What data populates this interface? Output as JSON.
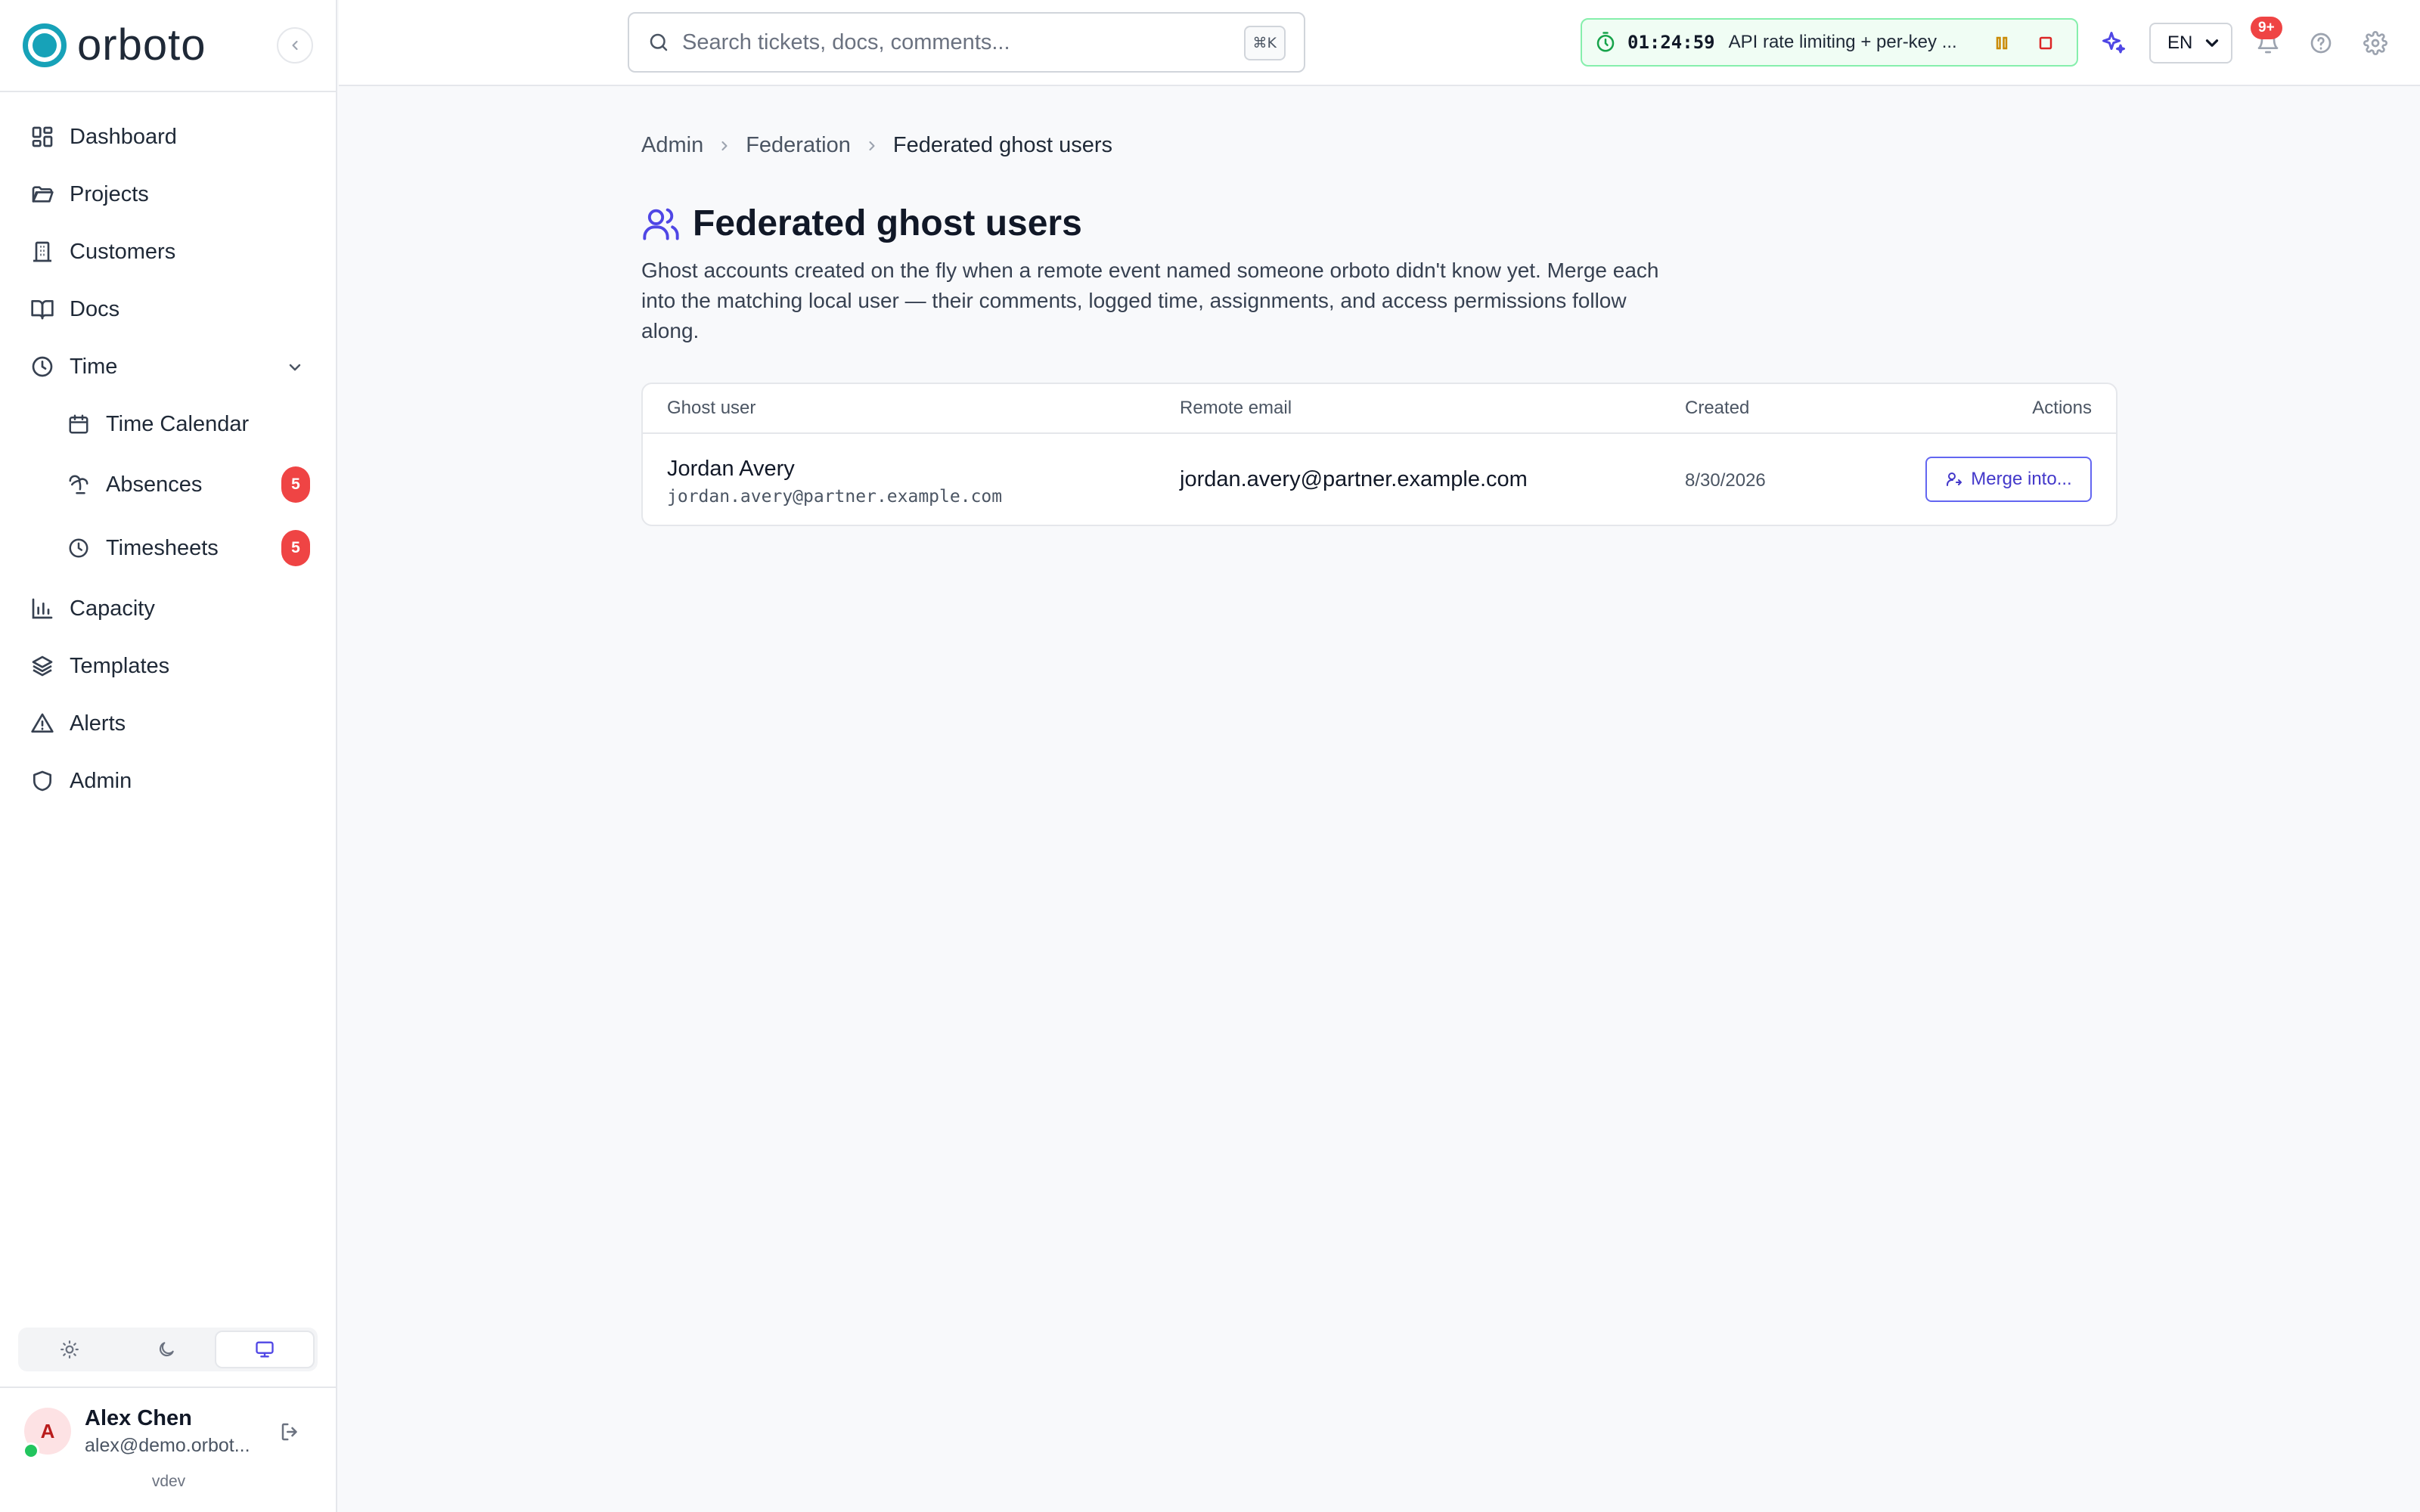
{
  "app": {
    "brand": "orboto",
    "version": "vdev"
  },
  "colors": {
    "brand": "#17a2b8",
    "accent": "#4f46e5",
    "danger": "#ef4444",
    "success": "#22c55e"
  },
  "sidebar": {
    "items": [
      {
        "label": "Dashboard",
        "icon": "dashboard-icon"
      },
      {
        "label": "Projects",
        "icon": "folder-icon"
      },
      {
        "label": "Customers",
        "icon": "building-icon"
      },
      {
        "label": "Docs",
        "icon": "book-icon"
      },
      {
        "label": "Time",
        "icon": "clock-icon"
      },
      {
        "label": "Capacity",
        "icon": "bar-chart-icon"
      },
      {
        "label": "Templates",
        "icon": "layers-icon"
      },
      {
        "label": "Alerts",
        "icon": "warning-icon"
      },
      {
        "label": "Admin",
        "icon": "shield-icon"
      }
    ],
    "time_children": [
      {
        "label": "Time Calendar",
        "icon": "calendar-icon"
      },
      {
        "label": "Absences",
        "icon": "palm-tree-icon",
        "badge": "5"
      },
      {
        "label": "Timesheets",
        "icon": "clock-icon",
        "badge": "5"
      }
    ],
    "theme_options": [
      "light",
      "dark",
      "system"
    ],
    "theme_selected": "system",
    "user": {
      "initial": "A",
      "name": "Alex Chen",
      "email": "alex@demo.orbot..."
    }
  },
  "topbar": {
    "search_placeholder": "Search tickets, docs, comments...",
    "search_shortcut": "⌘K",
    "timer": {
      "elapsed": "01:24:59",
      "task": "API rate limiting + per-key ..."
    },
    "language": "EN",
    "notifications_badge": "9+"
  },
  "breadcrumb": {
    "items": [
      "Admin",
      "Federation"
    ],
    "current": "Federated ghost users"
  },
  "page": {
    "title": "Federated ghost users",
    "description": "Ghost accounts created on the fly when a remote event named someone orboto didn't know yet. Merge each into the matching local user — their comments, logged time, assignments, and access permissions follow along."
  },
  "table": {
    "columns": [
      "Ghost user",
      "Remote email",
      "Created",
      "Actions"
    ],
    "rows": [
      {
        "name": "Jordan Avery",
        "handle": "jordan.avery@partner.example.com",
        "remote_email": "jordan.avery@partner.example.com",
        "created": "8/30/2026",
        "action_label": "Merge into..."
      }
    ]
  }
}
